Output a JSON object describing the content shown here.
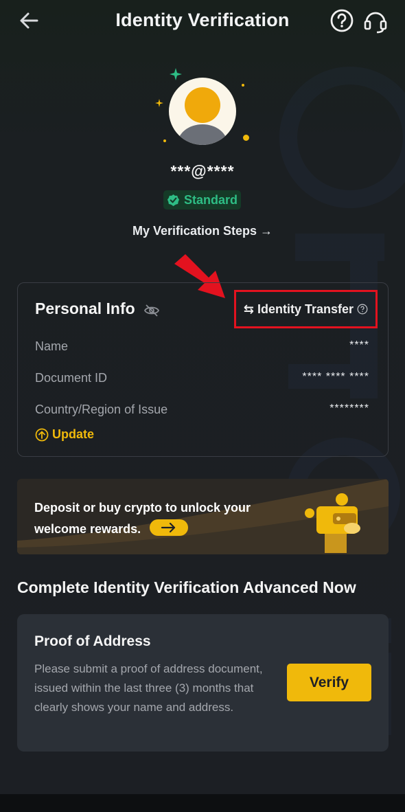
{
  "header": {
    "title": "Identity Verification",
    "back_icon": "arrow-left-icon",
    "help_icon": "question-circle-icon",
    "support_icon": "headset-icon"
  },
  "profile": {
    "email": "***@****",
    "level_badge": "Standard",
    "steps_link": "My Verification Steps"
  },
  "personal_info": {
    "title": "Personal Info",
    "transfer_label": "Identity Transfer",
    "rows": [
      {
        "label": "Name",
        "value": "****"
      },
      {
        "label": "Document ID",
        "value": "**** **** ****"
      },
      {
        "label": "Country/Region of Issue",
        "value": "********"
      }
    ],
    "update_label": "Update"
  },
  "banner": {
    "line1": "Deposit or buy crypto to unlock your",
    "line2": "welcome rewards."
  },
  "advanced": {
    "section_title": "Complete Identity Verification Advanced Now",
    "proof_title": "Proof of Address",
    "proof_desc": "Please submit a proof of address document, issued within the last three (3) months that clearly shows your name and address.",
    "verify_label": "Verify"
  },
  "colors": {
    "accent": "#f0b90b",
    "success": "#2ebd85",
    "highlight": "#e3121f"
  }
}
